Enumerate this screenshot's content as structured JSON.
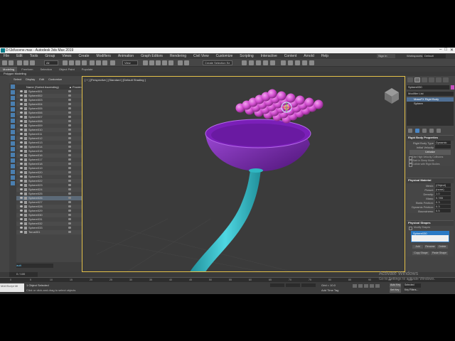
{
  "window": {
    "title": "D:\\3d\\scene.max - Autodesk 3ds Max 2019",
    "controls": [
      "–",
      "□",
      "✕"
    ]
  },
  "menu": [
    "File",
    "Edit",
    "Tools",
    "Group",
    "Views",
    "Create",
    "Modifiers",
    "Animation",
    "Graph Editors",
    "Rendering",
    "Civil View",
    "Customize",
    "Scripting",
    "Interactive",
    "Content",
    "Arnold",
    "Help"
  ],
  "signin": "Sign In",
  "workspaces_label": "Workspaces:",
  "workspaces_value": "Default",
  "toolbar": {
    "filter": "All",
    "view": "View",
    "selection_set": "Create Selection Se"
  },
  "ribbon": {
    "tabs": [
      "Modeling",
      "Freeform",
      "Selection",
      "Object Paint",
      "Populate"
    ],
    "active": 0,
    "sub": "Polygon Modeling"
  },
  "scene_explorer": {
    "menu": [
      "Select",
      "Display",
      "Edit",
      "Customize"
    ],
    "header_name": "Name (Sorted Ascending)",
    "header_frozen": "▲ Frozen",
    "items": [
      "Sphere001",
      "Sphere002",
      "Sphere003",
      "Sphere004",
      "Sphere005",
      "Sphere006",
      "Sphere007",
      "Sphere008",
      "Sphere009",
      "Sphere010",
      "Sphere011",
      "Sphere012",
      "Sphere013",
      "Sphere014",
      "Sphere015",
      "Sphere016",
      "Sphere017",
      "Sphere018",
      "Sphere019",
      "Sphere020",
      "Sphere021",
      "Sphere022",
      "Sphere023",
      "Sphere024",
      "Sphere025",
      "Sphere026",
      "Sphere027",
      "Sphere028",
      "Sphere029",
      "Sphere030",
      "Sphere031",
      "Sphere032",
      "Sphere033",
      "Torus001"
    ],
    "selected_index": 25,
    "layer": "Default"
  },
  "viewport": {
    "label": "[ + ] [Perspective ] [Standard ] [Default Shading ]"
  },
  "command_panel": {
    "object_name": "Sphere030",
    "modifier_list": "Modifier List",
    "stack": [
      "MassFX Rigid Body",
      "Sphere"
    ],
    "rigid_body": {
      "title": "Rigid Body Properties",
      "rows": [
        {
          "label": "Rigid Body Type",
          "value": "Dynamic"
        },
        {
          "label": "Initial Velocity",
          "value": ""
        }
      ],
      "unbake": "Unbake",
      "checks": [
        "Use High Velocity Collisions",
        "Start in Sleep Mode",
        "Collide with Rigid Bodies"
      ]
    },
    "physical_material": {
      "title": "Physical Material",
      "mesh_label": "Mesh:",
      "mesh_value": "(Object)",
      "preset_label": "Preset:",
      "preset_value": "(none)",
      "props": [
        {
          "label": "Density:",
          "value": "1.0"
        },
        {
          "label": "Mass:",
          "value": "0.785"
        },
        {
          "label": "Static Friction:",
          "value": "0.3"
        },
        {
          "label": "Dynamic Friction:",
          "value": "0.3"
        },
        {
          "label": "Bounciness:",
          "value": "0.5"
        }
      ]
    },
    "physical_shapes": {
      "title": "Physical Shapes",
      "modify_shapes": "Modify Shapes",
      "shape_item": "Sphere030",
      "buttons": [
        "Add",
        "Rename",
        "Delete",
        "Copy Shape",
        "Paste Shape"
      ]
    }
  },
  "timebar": {
    "frame": "0 / 100"
  },
  "timeline_ticks": [
    "0",
    "5",
    "10",
    "15",
    "20",
    "25",
    "30",
    "35",
    "40",
    "45",
    "50",
    "55",
    "60",
    "65",
    "70",
    "75",
    "80",
    "85",
    "90",
    "95",
    "100"
  ],
  "status": {
    "maxscript": "MAXScript Mi",
    "selected": "1 Object Selected",
    "prompt": "Click or click-and-drag to select objects",
    "grid": "Grid = 10.0",
    "add_time_tag": "Add Time Tag",
    "auto_key": "Auto Key",
    "set_key": "Set Key",
    "selected_dd": "Selected",
    "key_filters": "Key Filters..."
  },
  "watermark": {
    "line1": "Activate Windows",
    "line2": "Go to Settings to activate Windows."
  },
  "colors": {
    "bowl": "#8a2fc2",
    "spheres": "#d24fd0",
    "stem": "#2fb7c2",
    "viewport_bg": "#3b3b3b"
  }
}
